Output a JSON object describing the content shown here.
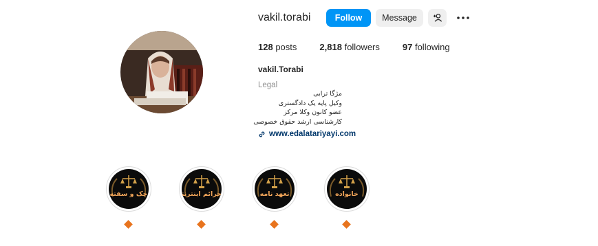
{
  "profile": {
    "username": "vakil.torabi",
    "full_name": "vakil.Torabi",
    "category": "Legal",
    "bio_lines": [
      "مژگا ترابی",
      "وکیل پایه یک دادگستری",
      "عضو کانون وکلا مرکز",
      "کارشناسی ارشد حقوق خصوصی"
    ],
    "link": "www.edalatariyayi.com"
  },
  "actions": {
    "follow_label": "Follow",
    "message_label": "Message",
    "add_user_icon": "person-plus-icon",
    "more_icon": "more-horizontal-icon"
  },
  "stats": {
    "posts_count": "128",
    "posts_label": "posts",
    "followers_count": "2,818",
    "followers_label": "followers",
    "following_count": "97",
    "following_label": "following"
  },
  "highlights": [
    {
      "title": "چک و سفته"
    },
    {
      "title": "جرائم اینترنتی"
    },
    {
      "title": "تعهد نامه"
    },
    {
      "title": "خانواده"
    }
  ],
  "colors": {
    "follow_button": "#0095f6",
    "link": "#00376b",
    "highlight_text": "#f2a65a",
    "highlight_marker": "#e8741e"
  }
}
